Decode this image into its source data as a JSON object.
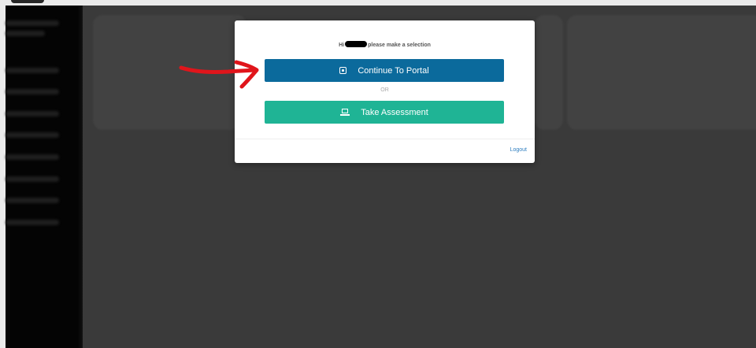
{
  "modal": {
    "greeting_prefix": "Hi",
    "greeting_suffix": "please make a selection",
    "portal_button_label": "Continue To Portal",
    "or_label": "OR",
    "assessment_button_label": "Take Assessment",
    "logout_label": "Logout"
  },
  "icons": {
    "portal": "portal-icon",
    "assessment": "laptop-icon"
  },
  "colors": {
    "portal_button": "#0b6a9c",
    "assessment_button": "#1fb495",
    "logout_link": "#2f7fc0",
    "annotation_arrow": "#e0151b",
    "sidebar": "#050505",
    "backdrop": "#3f3f3f"
  }
}
